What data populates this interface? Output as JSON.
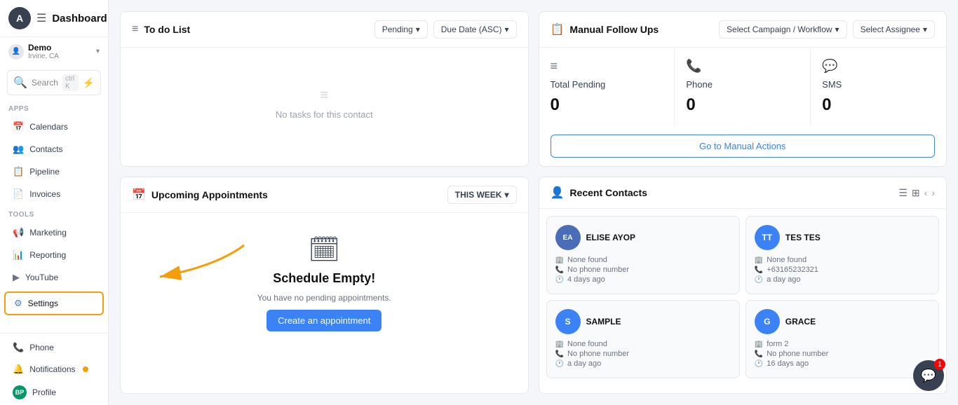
{
  "sidebar": {
    "avatar_letter": "A",
    "hamburger": "☰",
    "user": {
      "name": "Demo",
      "location": "Irvine, CA"
    },
    "search": {
      "placeholder": "Search",
      "shortcut": "ctrl K"
    },
    "apps_label": "Apps",
    "tools_label": "Tools",
    "nav_items": [
      {
        "id": "calendars",
        "label": "Calendars",
        "icon": "📅"
      },
      {
        "id": "contacts",
        "label": "Contacts",
        "icon": "👥"
      },
      {
        "id": "pipeline",
        "label": "Pipeline",
        "icon": "📋"
      },
      {
        "id": "invoices",
        "label": "Invoices",
        "icon": "📄"
      }
    ],
    "tool_items": [
      {
        "id": "marketing",
        "label": "Marketing",
        "icon": "📢"
      },
      {
        "id": "reporting",
        "label": "Reporting",
        "icon": "📊"
      },
      {
        "id": "youtube",
        "label": "YouTube",
        "icon": "▶"
      }
    ],
    "settings": {
      "label": "Settings",
      "icon": "⚙"
    },
    "bottom": [
      {
        "id": "phone",
        "label": "Phone",
        "icon": "📞"
      },
      {
        "id": "notifications",
        "label": "Notifications",
        "icon": "🔔"
      },
      {
        "id": "profile",
        "label": "Profile",
        "icon": "BP",
        "is_avatar": true
      }
    ]
  },
  "header": {
    "title": "Dashboard"
  },
  "todo": {
    "title": "To do List",
    "filters": {
      "status": "Pending",
      "sort": "Due Date (ASC)"
    },
    "empty_message": "No tasks for this contact"
  },
  "followups": {
    "title": "Manual Follow Ups",
    "filters": {
      "campaign": "Select Campaign / Workflow",
      "assignee": "Select Assignee"
    },
    "metrics": [
      {
        "label": "Total Pending",
        "value": "0",
        "icon": "≡"
      },
      {
        "label": "Phone",
        "value": "0",
        "icon": "📞"
      },
      {
        "label": "SMS",
        "value": "0",
        "icon": "💬"
      }
    ],
    "goto_label": "Go to Manual Actions"
  },
  "appointments": {
    "title": "Upcoming Appointments",
    "week_label": "THIS WEEK",
    "empty_title": "Schedule Empty!",
    "empty_sub": "You have no pending appointments.",
    "create_btn": "Create an appointment"
  },
  "contacts": {
    "title": "Recent Contacts",
    "items": [
      {
        "name": "ELISE AYOP",
        "source": "None found",
        "phone": "No phone number",
        "time": "4 days ago",
        "avatar_color": "#4b6cb7",
        "has_photo": true
      },
      {
        "name": "TES TES",
        "source": "None found",
        "phone": "+63165232321",
        "time": "a day ago",
        "avatar_color": "#3b82f6",
        "has_photo": false,
        "initials": "TT"
      },
      {
        "name": "SAMPLE",
        "source": "None found",
        "phone": "No phone number",
        "time": "a day ago",
        "avatar_color": "#3b82f6",
        "has_photo": false,
        "initials": "S"
      },
      {
        "name": "GRACE",
        "source": "form 2",
        "phone": "No phone number",
        "time": "16 days ago",
        "avatar_color": "#3b82f6",
        "has_photo": false,
        "initials": "G"
      }
    ]
  },
  "chat": {
    "badge": "1"
  }
}
